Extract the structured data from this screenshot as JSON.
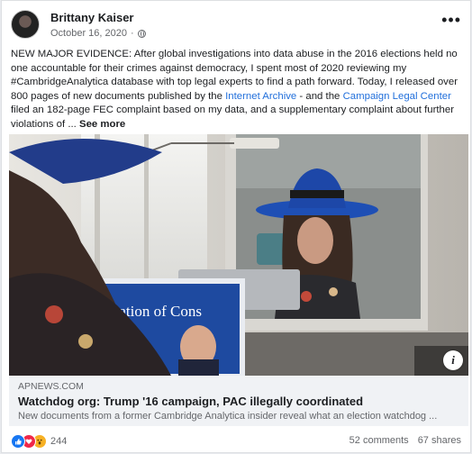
{
  "post": {
    "author": "Brittany Kaiser",
    "date": "October 16, 2020",
    "privacy_icon": "globe-icon",
    "menu_label": "•••",
    "text": {
      "p1": "NEW MAJOR EVIDENCE: After global investigations into data abuse in the 2016 elections held no one accountable for their crimes against democracy, I spent most of 2020 reviewing my #CambridgeAnalytica database with top legal experts to find a path forward. Today, I released over 800 pages of new documents published by the ",
      "link1": "Internet Archive",
      "p2": " - and the ",
      "link2": "Campaign Legal Center",
      "p3": " filed an 182-page FEC complaint based on my data, and a supplementary complaint about further violations of ... ",
      "see_more": "See more"
    }
  },
  "photo": {
    "screen_text": "tration of Cons",
    "info_label": "i"
  },
  "link_preview": {
    "domain": "APNEWS.COM",
    "headline": "Watchdog org: Trump '16 campaign, PAC illegally coordinated",
    "description": "New documents from a former Cambridge Analytica insider reveal what an election watchdog ..."
  },
  "footer": {
    "reactions": [
      "like",
      "love",
      "wow"
    ],
    "reaction_count": "244",
    "comments": "52 comments",
    "shares": "67 shares"
  },
  "colors": {
    "link": "#216fdb",
    "like": "#1877f2",
    "love": "#f0284a",
    "wow": "#f7b125"
  }
}
